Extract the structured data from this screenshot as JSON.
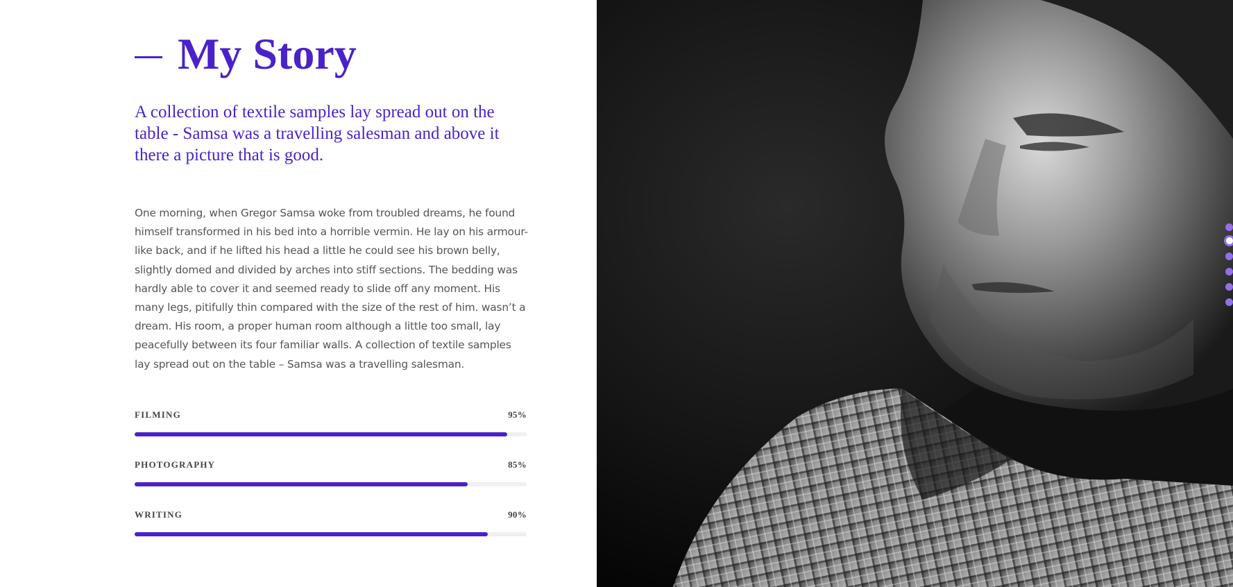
{
  "story": {
    "title": "My Story",
    "lead": "A collection of textile samples lay spread out on the table - Samsa was a travelling salesman and above it there a picture that is good.",
    "body": "One morning, when Gregor Samsa woke from troubled dreams, he found himself transformed in his bed into a horrible vermin. He lay on his armour-like back, and if he lifted his head a little he could see his brown belly, slightly domed and divided by arches into stiff sections. The bedding was hardly able to cover it and seemed ready to slide off any moment. His many legs, pitifully thin compared with the size of the rest of him. wasn’t a dream. His room, a proper human room although a little too small, lay peacefully between its four familiar walls. A collection of textile samples lay spread out on the table – Samsa was a travelling salesman."
  },
  "skills": [
    {
      "label": "FILMING",
      "percent_text": "95%",
      "value": 0.95
    },
    {
      "label": "PHOTOGRAPHY",
      "percent_text": "85%",
      "value": 0.85
    },
    {
      "label": "WRITING",
      "percent_text": "90%",
      "value": 0.9
    }
  ],
  "section_nav": {
    "count": 6,
    "active_index": 1
  },
  "colors": {
    "accent": "#4a22c9",
    "nav_dot": "#9370e8",
    "body_text": "#555555",
    "track": "#f0f0f2"
  },
  "icons": {
    "heading_decoration": "horizontal-dash-icon"
  }
}
